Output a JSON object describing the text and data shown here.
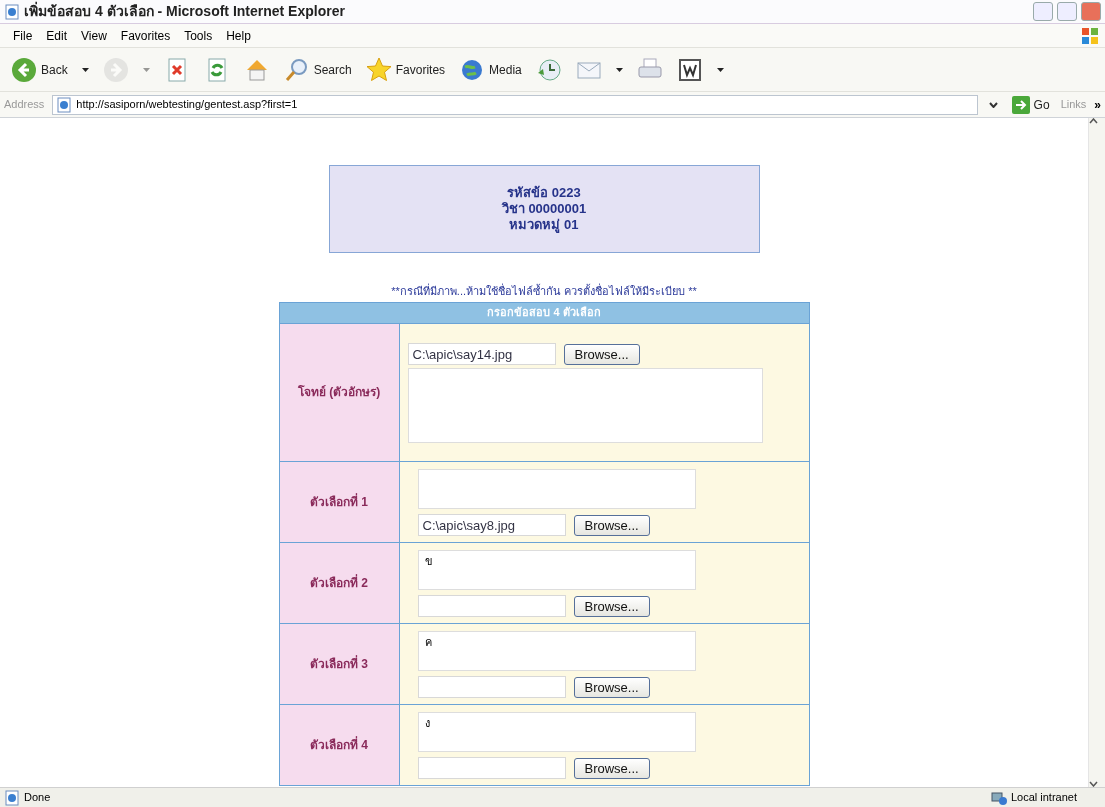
{
  "window": {
    "title": "เพิ่มข้อสอบ 4 ตัวเลือก - Microsoft Internet Explorer"
  },
  "menu": [
    "File",
    "Edit",
    "View",
    "Favorites",
    "Tools",
    "Help"
  ],
  "toolbar": [
    {
      "kind": "back",
      "label": "Back",
      "dropdown": true
    },
    {
      "kind": "forward",
      "disabled": true,
      "dropdown": true
    },
    {
      "kind": "stop"
    },
    {
      "kind": "refresh"
    },
    {
      "kind": "home"
    },
    {
      "kind": "search",
      "label": "Search"
    },
    {
      "kind": "favorites",
      "label": "Favorites"
    },
    {
      "kind": "media",
      "label": "Media"
    },
    {
      "kind": "history"
    },
    {
      "kind": "mail",
      "dropdown": true
    },
    {
      "kind": "print"
    },
    {
      "kind": "word",
      "dropdown": true
    }
  ],
  "address": {
    "label": "Address",
    "value": "http://sasiporn/webtesting/gentest.asp?first=1",
    "go": "Go",
    "links": "Links",
    "more": "»"
  },
  "info_box": [
    "รหัสข้อ 0223",
    "วิชา 00000001",
    "หมวดหมู่ 01"
  ],
  "notice": "**กรณีที่มีภาพ...ห้ามใช้ชื่อไฟล์ซ้ำกัน ควรตั้งชื่อไฟล์ให้มีระเบียบ **",
  "form": {
    "title": "กรอกข้อสอบ 4 ตัวเลือก",
    "rows": [
      {
        "kind": "question",
        "label": "โจทย์ (ตัวอักษร)",
        "file": "C:\\apic\\say14.jpg",
        "browse": "Browse..."
      },
      {
        "kind": "option",
        "label": "ตัวเลือกที่ 1",
        "file": "C:\\apic\\say8.jpg",
        "browse": "Browse..."
      },
      {
        "kind": "option",
        "label": "ตัวเลือกที่ 2",
        "text": "ข",
        "browse": "Browse..."
      },
      {
        "kind": "option",
        "label": "ตัวเลือกที่ 3",
        "text": "ค",
        "browse": "Browse..."
      },
      {
        "kind": "option",
        "label": "ตัวเลือกที่ 4",
        "text": "ง",
        "browse": "Browse..."
      }
    ]
  },
  "status_bar": {
    "text": "Done",
    "zone": "Local intranet"
  }
}
